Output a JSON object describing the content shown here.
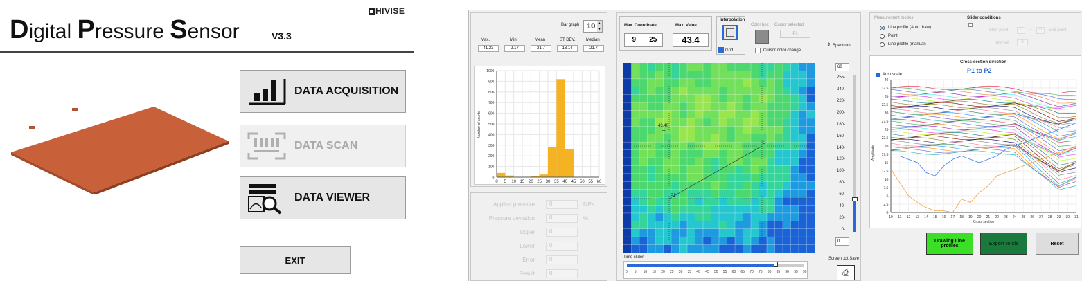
{
  "left": {
    "brand": "HIVISE",
    "title": {
      "d1": "D",
      "w1": "igital ",
      "d2": "P",
      "w2": "ressure ",
      "d3": "S",
      "w3": "ensor"
    },
    "version": "V3.3",
    "buttons": {
      "acq": "DATA ACQUISITION",
      "scan": "DATA SCAN",
      "viewer": "DATA VIEWER",
      "exit": "EXIT"
    },
    "sensor_color": "#c8603a"
  },
  "app": {
    "bar_graph": {
      "label": "Bar graph",
      "value": "10"
    },
    "stats": {
      "headers": [
        "Max.",
        "Min.",
        "Mean",
        "ST DEV.",
        "Median"
      ],
      "values": [
        "41.23",
        "2.17",
        "21.7",
        "13.14",
        "21.7"
      ]
    },
    "histogram": {
      "ylabel": "Number of counts",
      "yticks": [
        "1000-",
        "900-",
        "800-",
        "700-",
        "600-",
        "500-",
        "400-",
        "300-",
        "200-",
        "100-",
        "0-"
      ],
      "xticks": [
        "0",
        "5",
        "10",
        "15",
        "20",
        "25",
        "30",
        "35",
        "40",
        "45",
        "50",
        "55",
        "60"
      ],
      "bins": [
        2.5,
        7.5,
        12.5,
        17.5,
        22.5,
        27.5,
        32.5,
        37.5,
        42.5,
        47.5,
        52.5,
        57.5
      ],
      "values": [
        40,
        15,
        0,
        0,
        10,
        25,
        280,
        920,
        260,
        0,
        0,
        0
      ],
      "ylim": [
        0,
        1000
      ],
      "bar_color": "#f5b323"
    },
    "pressure": {
      "rows": [
        {
          "label": "Applied pressure",
          "value": "0",
          "unit": "MPa"
        },
        {
          "label": "Pressure deviation",
          "value": "0",
          "unit": "%"
        },
        {
          "label": "Upper",
          "value": "0",
          "unit": ""
        },
        {
          "label": "Lower",
          "value": "0",
          "unit": ""
        },
        {
          "label": "Error",
          "value": "0",
          "unit": ""
        },
        {
          "label": "Result",
          "value": "0",
          "unit": ""
        }
      ]
    },
    "maxcoord": {
      "label": "Max. Coordinate",
      "x": "9",
      "y": "25"
    },
    "maxvalue": {
      "label": "Max. Value",
      "value": "43.4"
    },
    "interp": {
      "label": "Interpolation",
      "grid": "Grid"
    },
    "colorbox": {
      "label": "Color box",
      "cursor_change": "Cursor color change"
    },
    "cursor_sel": {
      "label": "Cursor selected",
      "value": "P1"
    },
    "spectrum": "Spectrum",
    "heatmap": {
      "max_annot": "43.40",
      "p1": "P1",
      "p2": "P2"
    },
    "colorbar": {
      "top": "60",
      "bottom": "0",
      "ticks": [
        "255-",
        "240-",
        "220-",
        "200-",
        "180-",
        "160-",
        "140-",
        "120-",
        "100-",
        "80-",
        "60-",
        "40-",
        "20-",
        "0-"
      ]
    },
    "time_slider": {
      "label": "Time slider",
      "ticks": [
        "0",
        "5",
        "10",
        "15",
        "20",
        "25",
        "30",
        "35",
        "40",
        "45",
        "50",
        "55",
        "60",
        "65",
        "70",
        "75",
        "80",
        "85",
        "90",
        "95",
        "99"
      ],
      "value": 83
    },
    "screen_save": "Screen .txt Save",
    "modes": {
      "label": "Measurement modes",
      "items": [
        "Line profile (Auto draw)",
        "Point",
        "Line profile (manual)"
      ]
    },
    "slider_cond": {
      "label": "Slider conditions",
      "start": "Start point",
      "end": "End point",
      "interval": "Interval",
      "start_val": "0",
      "end_val": "0",
      "interval_val": "0"
    },
    "line_chart": {
      "title": "Cross-section direction",
      "subtitle": "P1 to P2",
      "autoscale": "Auto scale",
      "ylabel": "Amplitude",
      "xlabel": "Cross section",
      "yticks": [
        "40-",
        "37.5-",
        "35-",
        "32.5-",
        "30-",
        "27.5-",
        "25-",
        "22.5-",
        "20-",
        "17.5-",
        "15-",
        "12.5-",
        "10-",
        "7.5-",
        "5-",
        "2.5-",
        "0-"
      ],
      "xticks": [
        "10",
        "11",
        "12",
        "13",
        "14",
        "15",
        "16",
        "17",
        "18",
        "19",
        "20",
        "21",
        "22",
        "23",
        "24",
        "25",
        "26",
        "27",
        "28",
        "29",
        "30",
        "31"
      ]
    },
    "buttons": {
      "drawing": "Drawing Line profiles",
      "export": "Export to xls",
      "reset": "Reset",
      "drawing_color": "#3adf26",
      "export_color": "#1a7a3e"
    }
  }
}
